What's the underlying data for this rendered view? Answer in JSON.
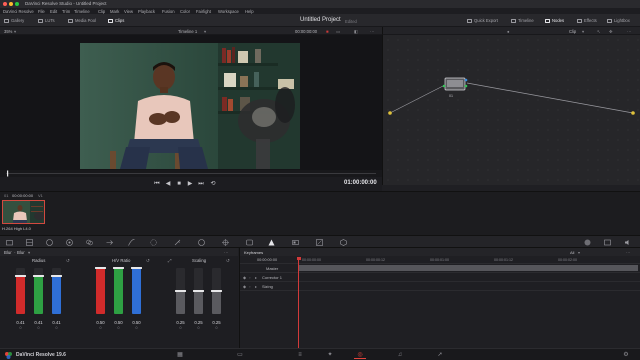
{
  "window": {
    "title": "DaVinci Resolve Studio - Untitled Project",
    "dot_colors": [
      "#ff5f57",
      "#febc2e",
      "#28c840"
    ]
  },
  "menubar": {
    "items": [
      "DaVinci Resolve",
      "File",
      "Edit",
      "Trim",
      "Timeline",
      "Clip",
      "Mark",
      "View",
      "Playback",
      "Fusion",
      "Color",
      "Fairlight",
      "Workspace",
      "Help"
    ]
  },
  "toolbar": {
    "gallery": "Gallery",
    "luts": "LUTs",
    "media_pool": "Media Pool",
    "clips": "Clips",
    "project_title": "Untitled Project",
    "project_status": "Edited",
    "quick_export": "Quick Export",
    "timeline": "Timeline",
    "nodes": "Nodes",
    "effects": "Effects",
    "lightbox": "Lightbox"
  },
  "viewer": {
    "zoom": "35%",
    "timeline_name": "Timeline 1",
    "source_timecode": "00:00:00:00",
    "node_mode": "Clip",
    "timecode": "01:00:00:00"
  },
  "clip": {
    "number": "01",
    "timecode": "00:00:00:00",
    "track": "V1",
    "codec": "H.264 High L4.0"
  },
  "primaries": {
    "mode": "Blur",
    "mode2": "Blur",
    "groups": [
      {
        "title": "Radius",
        "values": [
          "0.41",
          "0.41",
          "0.41"
        ],
        "subs": [
          "0",
          "0",
          "0"
        ],
        "levels": [
          0.41,
          0.41,
          0.41
        ],
        "colors": [
          "#d12b2b",
          "#2ea043",
          "#2f6fd6"
        ]
      },
      {
        "title": "H/V Ratio",
        "values": [
          "0.50",
          "0.50",
          "0.50"
        ],
        "subs": [
          "0",
          "0",
          "0"
        ],
        "levels": [
          0.5,
          0.5,
          0.5
        ],
        "colors": [
          "#d12b2b",
          "#2ea043",
          "#2f6fd6"
        ]
      },
      {
        "title": "Scaling",
        "values": [
          "0.25",
          "0.25",
          "0.25"
        ],
        "subs": [
          "0",
          "0",
          "0"
        ],
        "levels": [
          0.25,
          0.25,
          0.25
        ],
        "colors": [
          "#5a5a5f",
          "#5a5a5f",
          "#5a5a5f"
        ]
      }
    ]
  },
  "keyframes": {
    "title": "Keyframes",
    "filter": "All",
    "timecode": "00:00:00:00",
    "rows": [
      "Master",
      "Corrector 1",
      "Sizing"
    ],
    "ruler": [
      "00:00:00:00",
      "00:00:00:12",
      "00:00:01:00",
      "00:00:01:12",
      "00:00:02:00"
    ]
  },
  "footer": {
    "version": "DaVinci Resolve 19.6"
  }
}
